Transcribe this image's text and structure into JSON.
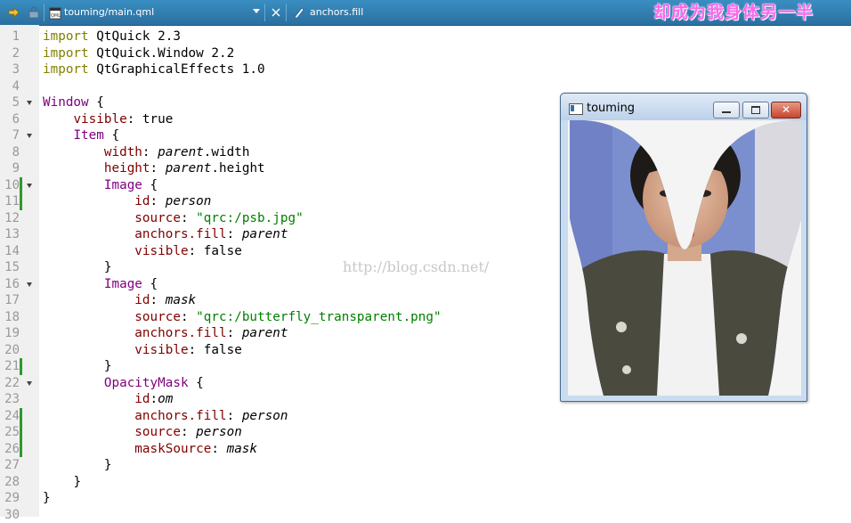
{
  "editor": {
    "tab_file_name": "touming/main.qml",
    "symbol_label": "anchors.fill",
    "banner_text": "却成为我身体另一半",
    "watermark": "http://blog.csdn.net/",
    "line_numbers": [
      "1",
      "2",
      "3",
      "4",
      "5",
      "6",
      "7",
      "8",
      "9",
      "10",
      "11",
      "12",
      "13",
      "14",
      "15",
      "16",
      "17",
      "18",
      "19",
      "20",
      "21",
      "22",
      "23",
      "24",
      "25",
      "26",
      "27",
      "28",
      "29",
      "30"
    ],
    "code_lines": [
      {
        "indent": "",
        "segments": [
          {
            "t": "import",
            "c": "kw"
          },
          {
            "t": " QtQuick 2.3",
            "c": ""
          }
        ]
      },
      {
        "indent": "",
        "segments": [
          {
            "t": "import",
            "c": "kw"
          },
          {
            "t": " QtQuick.Window 2.2",
            "c": ""
          }
        ]
      },
      {
        "indent": "",
        "segments": [
          {
            "t": "import",
            "c": "kw"
          },
          {
            "t": " QtGraphicalEffects 1.0",
            "c": ""
          }
        ]
      },
      {
        "indent": "",
        "segments": []
      },
      {
        "indent": "",
        "segments": [
          {
            "t": "Window",
            "c": "type"
          },
          {
            "t": " {",
            "c": ""
          }
        ]
      },
      {
        "indent": "    ",
        "segments": [
          {
            "t": "visible",
            "c": "prop"
          },
          {
            "t": ": true",
            "c": ""
          }
        ]
      },
      {
        "indent": "    ",
        "segments": [
          {
            "t": "Item",
            "c": "type"
          },
          {
            "t": " {",
            "c": ""
          }
        ]
      },
      {
        "indent": "        ",
        "segments": [
          {
            "t": "width",
            "c": "prop"
          },
          {
            "t": ": ",
            "c": ""
          },
          {
            "t": "parent",
            "c": "it"
          },
          {
            "t": ".width",
            "c": ""
          }
        ]
      },
      {
        "indent": "        ",
        "segments": [
          {
            "t": "height",
            "c": "prop"
          },
          {
            "t": ": ",
            "c": ""
          },
          {
            "t": "parent",
            "c": "it"
          },
          {
            "t": ".height",
            "c": ""
          }
        ]
      },
      {
        "indent": "        ",
        "segments": [
          {
            "t": "Image",
            "c": "type"
          },
          {
            "t": " {",
            "c": ""
          }
        ]
      },
      {
        "indent": "            ",
        "segments": [
          {
            "t": "id",
            "c": "prop"
          },
          {
            "t": ": ",
            "c": ""
          },
          {
            "t": "person",
            "c": "it"
          }
        ]
      },
      {
        "indent": "            ",
        "segments": [
          {
            "t": "source",
            "c": "prop"
          },
          {
            "t": ": ",
            "c": ""
          },
          {
            "t": "\"qrc:/psb.jpg\"",
            "c": "str"
          }
        ]
      },
      {
        "indent": "            ",
        "segments": [
          {
            "t": "anchors.fill",
            "c": "prop"
          },
          {
            "t": ": ",
            "c": ""
          },
          {
            "t": "parent",
            "c": "it"
          }
        ]
      },
      {
        "indent": "            ",
        "segments": [
          {
            "t": "visible",
            "c": "prop"
          },
          {
            "t": ": false",
            "c": ""
          }
        ]
      },
      {
        "indent": "        ",
        "segments": [
          {
            "t": "}",
            "c": ""
          }
        ]
      },
      {
        "indent": "        ",
        "segments": [
          {
            "t": "Image",
            "c": "type"
          },
          {
            "t": " {",
            "c": ""
          }
        ]
      },
      {
        "indent": "            ",
        "segments": [
          {
            "t": "id",
            "c": "prop"
          },
          {
            "t": ": ",
            "c": ""
          },
          {
            "t": "mask",
            "c": "it"
          }
        ]
      },
      {
        "indent": "            ",
        "segments": [
          {
            "t": "source",
            "c": "prop"
          },
          {
            "t": ": ",
            "c": ""
          },
          {
            "t": "\"qrc:/butterfly_transparent.png\"",
            "c": "str"
          }
        ]
      },
      {
        "indent": "            ",
        "segments": [
          {
            "t": "anchors.fill",
            "c": "prop"
          },
          {
            "t": ": ",
            "c": ""
          },
          {
            "t": "parent",
            "c": "it"
          }
        ]
      },
      {
        "indent": "            ",
        "segments": [
          {
            "t": "visible",
            "c": "prop"
          },
          {
            "t": ": false",
            "c": ""
          }
        ]
      },
      {
        "indent": "        ",
        "segments": [
          {
            "t": "}",
            "c": ""
          }
        ]
      },
      {
        "indent": "        ",
        "segments": [
          {
            "t": "OpacityMask",
            "c": "type"
          },
          {
            "t": " {",
            "c": ""
          }
        ]
      },
      {
        "indent": "            ",
        "segments": [
          {
            "t": "id",
            "c": "prop"
          },
          {
            "t": ":",
            "c": ""
          },
          {
            "t": "om",
            "c": "it"
          }
        ]
      },
      {
        "indent": "            ",
        "segments": [
          {
            "t": "anchors.fill",
            "c": "prop"
          },
          {
            "t": ": ",
            "c": ""
          },
          {
            "t": "person",
            "c": "it"
          }
        ]
      },
      {
        "indent": "            ",
        "segments": [
          {
            "t": "source",
            "c": "prop"
          },
          {
            "t": ": ",
            "c": ""
          },
          {
            "t": "person",
            "c": "it"
          }
        ]
      },
      {
        "indent": "            ",
        "segments": [
          {
            "t": "maskSource",
            "c": "prop"
          },
          {
            "t": ": ",
            "c": ""
          },
          {
            "t": "mask",
            "c": "it"
          }
        ]
      },
      {
        "indent": "        ",
        "segments": [
          {
            "t": "}",
            "c": ""
          }
        ]
      },
      {
        "indent": "    ",
        "segments": [
          {
            "t": "}",
            "c": ""
          }
        ]
      },
      {
        "indent": "",
        "segments": [
          {
            "t": "}",
            "c": ""
          }
        ]
      },
      {
        "indent": "",
        "segments": []
      }
    ],
    "fold_lines": [
      5,
      7,
      10,
      16,
      22
    ],
    "changed_line_ranges": [
      [
        10,
        11
      ],
      [
        21,
        21
      ],
      [
        24,
        26
      ]
    ]
  },
  "preview_window": {
    "title": "touming",
    "close_glyph": "✕"
  },
  "colors": {
    "keyword": "#808000",
    "type": "#800080",
    "property": "#800000",
    "string": "#008000",
    "banner": "#ff66ee",
    "tabbar": "#2f7cb0"
  },
  "icons": [
    "nav-arrow-icon",
    "lock-icon",
    "qml-file-icon",
    "dropdown-arrow-icon",
    "close-tab-icon",
    "symbol-icon",
    "app-icon",
    "minimize-icon",
    "maximize-icon",
    "close-icon"
  ]
}
